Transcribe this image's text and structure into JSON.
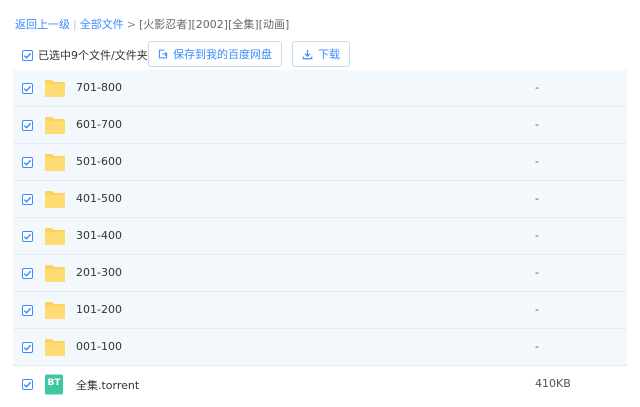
{
  "breadcrumb": {
    "back": "返回上一级",
    "separator": "|",
    "all_files": "全部文件",
    "arrow": ">",
    "current": "[火影忍者][2002][全集][动画]"
  },
  "toolbar": {
    "selected_text": "已选中9个文件/文件夹",
    "save_label": "保存到我的百度网盘",
    "download_label": "下载"
  },
  "colors": {
    "accent": "#3b8cff",
    "folder": "#ffd35a",
    "torrent": "#3ec8a0",
    "row_bg": "#f3f8fd"
  },
  "files": [
    {
      "name": "701-800",
      "size": "-",
      "type": "folder-icon",
      "checked": true
    },
    {
      "name": "601-700",
      "size": "-",
      "type": "folder-icon",
      "checked": true
    },
    {
      "name": "501-600",
      "size": "-",
      "type": "folder-icon",
      "checked": true
    },
    {
      "name": "401-500",
      "size": "-",
      "type": "folder-icon",
      "checked": true
    },
    {
      "name": "301-400",
      "size": "-",
      "type": "folder-icon",
      "checked": true
    },
    {
      "name": "201-300",
      "size": "-",
      "type": "folder-icon",
      "checked": true
    },
    {
      "name": "101-200",
      "size": "-",
      "type": "folder-icon",
      "checked": true
    },
    {
      "name": "001-100",
      "size": "-",
      "type": "folder-icon",
      "checked": true
    },
    {
      "name": "全集.torrent",
      "size": "410KB",
      "type": "torrent-icon",
      "icon_text": "BT",
      "checked": true
    }
  ]
}
